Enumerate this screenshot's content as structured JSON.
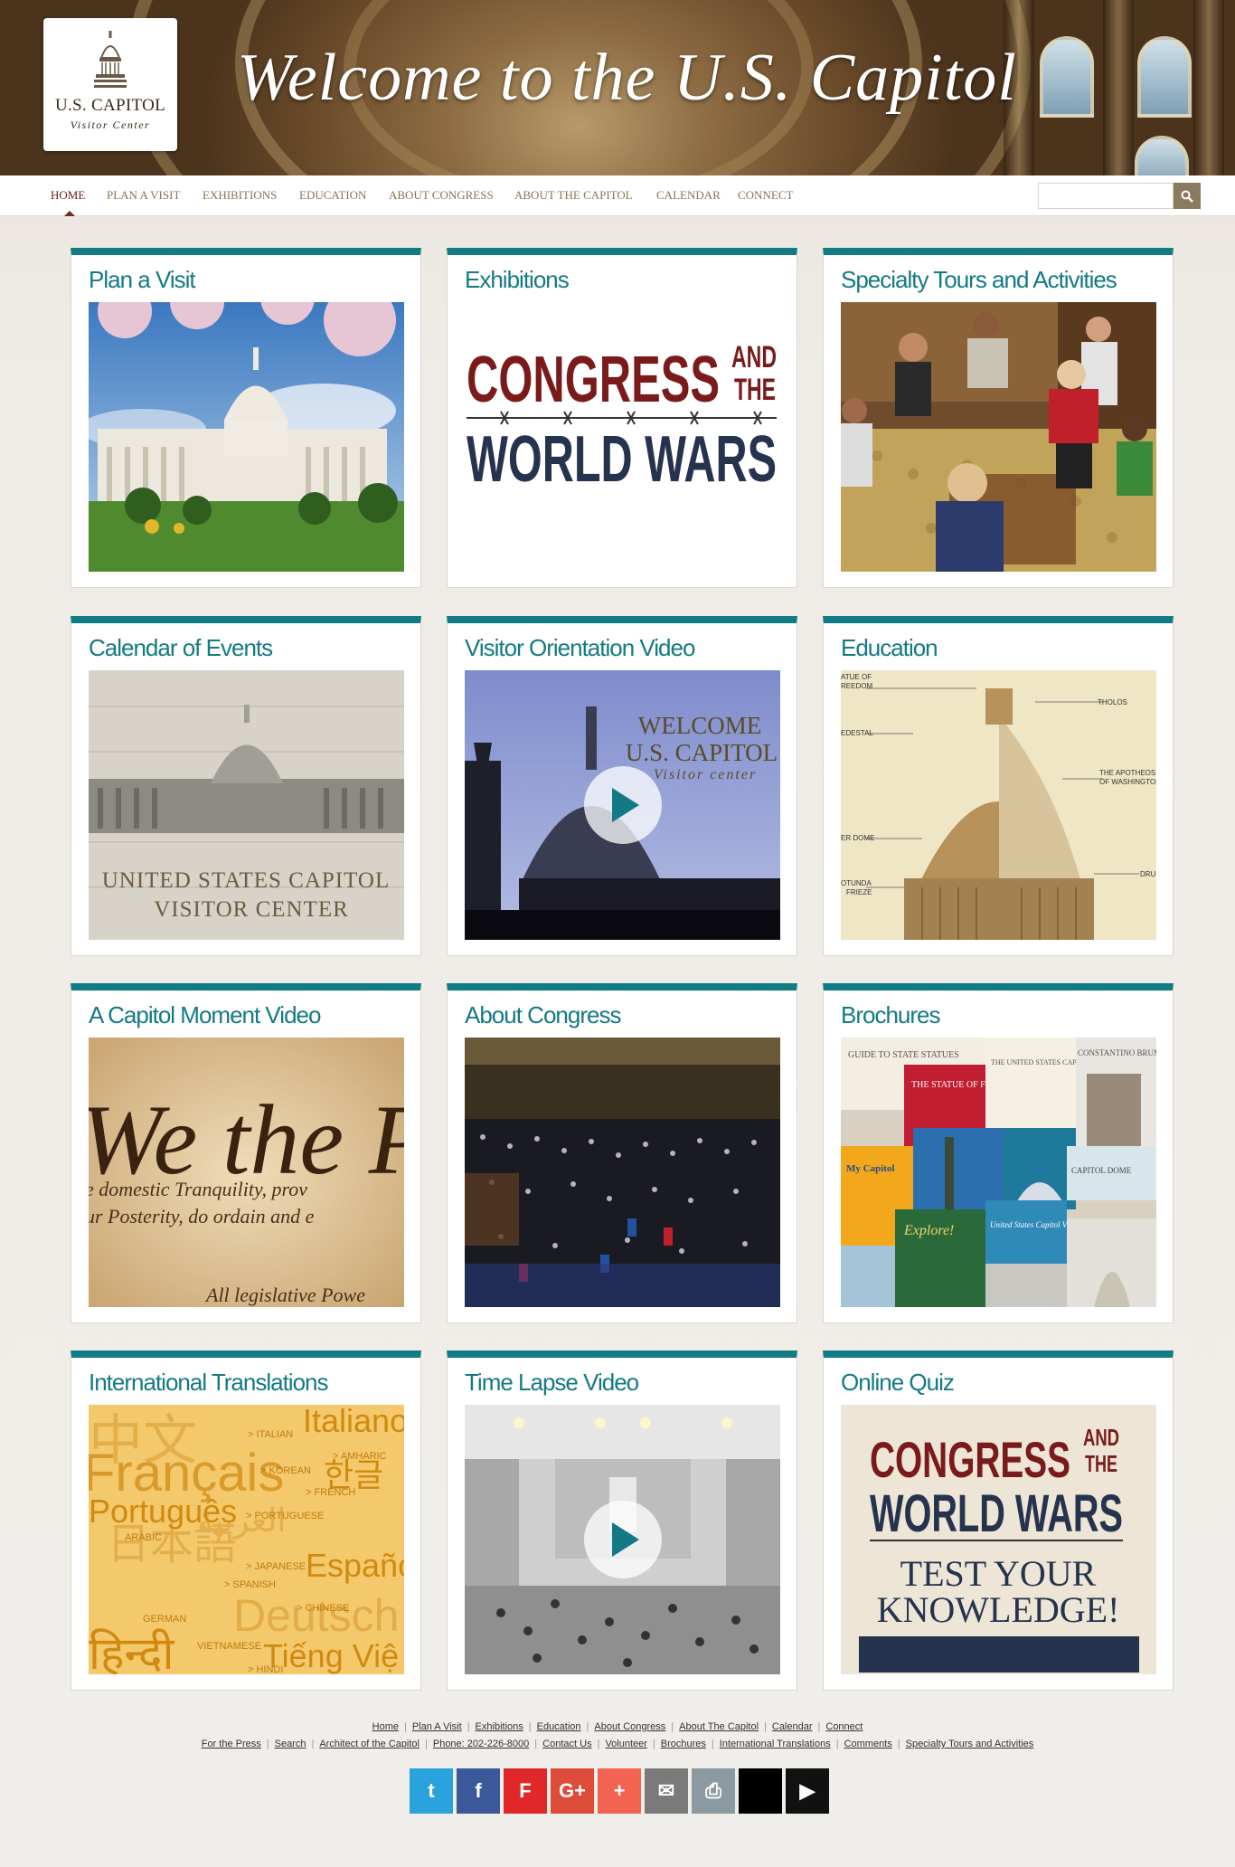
{
  "banner": {
    "title": "Welcome to the U.S. Capitol",
    "logo_title": "U.S. CAPITOL",
    "logo_subtitle": "Visitor Center"
  },
  "nav": {
    "items": [
      {
        "label": "HOME",
        "active": true
      },
      {
        "label": "PLAN A VISIT"
      },
      {
        "label": "EXHIBITIONS"
      },
      {
        "label": "EDUCATION"
      },
      {
        "label": "ABOUT CONGRESS"
      },
      {
        "label": "ABOUT THE CAPITOL"
      },
      {
        "label": "CALENDAR"
      },
      {
        "label": "CONNECT"
      }
    ],
    "search_placeholder": "",
    "search_icon": "search-icon"
  },
  "cards": [
    {
      "title": "Plan a Visit"
    },
    {
      "title": "Exhibitions",
      "image_text": {
        "line1": "CONGRESS",
        "and": "AND",
        "the": "THE",
        "line2": "WORLD WARS"
      }
    },
    {
      "title": "Specialty Tours and Activities"
    },
    {
      "title": "Calendar of Events",
      "image_text": {
        "line1": "UNITED STATES CAPITOL",
        "line2": "VISITOR CENTER"
      }
    },
    {
      "title": "Visitor Orientation Video",
      "image_text": {
        "line1": "WELCOME",
        "line2": "U.S. CAPITOL",
        "line3": "Visitor center"
      }
    },
    {
      "title": "Education",
      "image_text": {
        "l1": "ATUE OF",
        "l1b": "REEDOM",
        "l2": "EDESTAL",
        "l3": "ER DOME",
        "l4": "OTUNDA",
        "l4b": "FRIEZE",
        "r1": "THOLOS",
        "r2": "THE APOTHEOSIS",
        "r2b": "OF WASHINGTON",
        "r3": "DRU"
      }
    },
    {
      "title": "A Capitol Moment Video",
      "image_text": {
        "big": "We the Pe",
        "line1": "e domestic Tranquility, prov",
        "line2": "ur Posterity, do ordain and e",
        "line3": "All legislative Powe"
      }
    },
    {
      "title": "About Congress"
    },
    {
      "title": "Brochures",
      "image_text": {
        "b1": "GUIDE TO STATE STATUES",
        "b2": "THE STATUE OF FREEDOM",
        "b3": "THE UNITED STATES CAPITOL AND CONGRESS",
        "b4": "CONSTANTINO BRUMIDI",
        "b5": "My Capitol",
        "b6": "CAPITOL DOME",
        "b7": "Explore!",
        "b8": "United States Capitol VISITOR GUIDE"
      }
    },
    {
      "title": "International Translations",
      "image_text": {
        "w1": "Italiano",
        "w2": "Français",
        "w3": "Português",
        "w4": "Español",
        "w5": "Deutsch",
        "w6": "Tiếng Việ",
        "w7": "한글",
        "w8": "العربية",
        "w9": "日本語",
        "w10": "中文",
        "w11": "हिन्दी",
        "s1": "> ITALIAN",
        "s2": "> KOREAN",
        "s3": "> FRENCH",
        "s4": "> PORTUGUESE",
        "s5": "ARABIC",
        "s6": "> JAPANESE",
        "s7": "> SPANISH",
        "s8": "> CHINESE",
        "s9": "GERMAN",
        "s10": "VIETNAMESE",
        "s11": "> HINDI",
        "s12": "> AMHARIC"
      }
    },
    {
      "title": "Time Lapse Video"
    },
    {
      "title": "Online Quiz",
      "image_text": {
        "line1": "CONGRESS",
        "and": "AND",
        "the": "THE",
        "line2": "WORLD WARS",
        "line3": "TEST YOUR",
        "line4": "KNOWLEDGE!"
      }
    }
  ],
  "footer": {
    "row1": [
      "Home",
      "Plan A Visit",
      "Exhibitions",
      "Education",
      "About Congress",
      "About The Capitol",
      "Calendar",
      "Connect"
    ],
    "row2": [
      "For the Press",
      "Search",
      "Architect of the Capitol",
      "Phone: 202-226-8000",
      "Contact Us",
      "Volunteer",
      "Brochures",
      "International Translations",
      "Comments",
      "Specialty Tours and Activities"
    ]
  },
  "social": [
    {
      "name": "twitter-icon",
      "glyph": "t",
      "color": "#2aa3dc"
    },
    {
      "name": "facebook-icon",
      "glyph": "f",
      "color": "#3b5998"
    },
    {
      "name": "flipboard-icon",
      "glyph": "F",
      "color": "#e12828"
    },
    {
      "name": "google-plus-icon",
      "glyph": "G+",
      "color": "#dd4b39"
    },
    {
      "name": "add-plus-icon",
      "glyph": "+",
      "color": "#f26451"
    },
    {
      "name": "email-icon",
      "glyph": "✉",
      "color": "#7a7a7a"
    },
    {
      "name": "print-icon",
      "glyph": "⎙",
      "color": "#8a9aa0"
    },
    {
      "name": "apple-icon",
      "glyph": "",
      "color": "#000000"
    },
    {
      "name": "google-play-icon",
      "glyph": "▶",
      "color": "#111111"
    }
  ],
  "colors": {
    "accent": "#137a85",
    "nav_active": "#6a2418",
    "nav_text": "#8b7355"
  }
}
